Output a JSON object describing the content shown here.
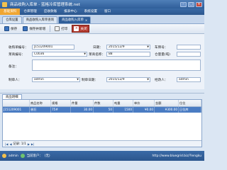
{
  "window": {
    "title": "商品收购入库单 - 蓝格冷库管理系统.net",
    "buttons": [
      "–",
      "□",
      "×"
    ]
  },
  "menu": {
    "items": [
      "基础资料",
      "仓库管理",
      "应收款账",
      "报表中心",
      "系统设置",
      "窗口"
    ]
  },
  "module_tabs": [
    {
      "label": "仓库设置",
      "active": false
    },
    {
      "label": "商品收购入库单查询",
      "active": false
    },
    {
      "label": "商品收购入库单",
      "active": true
    }
  ],
  "toolbar": {
    "save": "保存",
    "save_new": "保存并新增",
    "print": "打印",
    "close": "关闭"
  },
  "form": {
    "doc_no_label": "收购单编号：",
    "doc_no": "J151209001",
    "date_label": "日期：",
    "date": "2015/12/9",
    "plate_label": "车牌号：",
    "plate": "",
    "supplier_no_label": "莱商编号：",
    "supplier_no": "C0036",
    "supplier_name_label": "莱商名称：",
    "supplier_name": "88",
    "loc_no_label": "仓量量(吨)",
    "note_label": "备注：",
    "maker_label": "制单人：",
    "maker": "admin",
    "make_date_label": "制单日期：",
    "make_date": "2015/12/9",
    "modifier_label": "经改人：",
    "modifier": "admin"
  },
  "detail": {
    "tab": "商品明细",
    "columns": [
      "商品名称",
      "规格",
      "件量",
      "件数",
      "吨量",
      "单价",
      "金额",
      "位位"
    ],
    "rows": [
      {
        "code": "J151209001",
        "name": "香狂",
        "spec": "75#",
        "qty": "30.00",
        "pieces": "50",
        "weight": "1500",
        "price": "¥0.00",
        "amount": "¥300.00",
        "location": "日位库"
      }
    ],
    "pager": "记录: 1/1"
  },
  "statusbar": {
    "user": "admin",
    "client_label": "当前客户：",
    "client": "(无)",
    "url": "http://www.bluegrid.biz/?lengku"
  }
}
